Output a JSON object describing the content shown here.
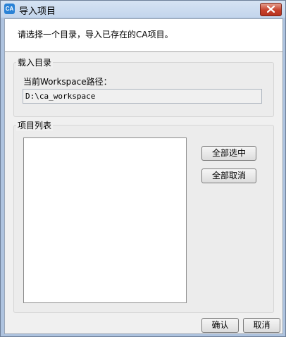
{
  "window": {
    "icon_text": "CA",
    "title": "导入项目",
    "close_icon": "close-icon"
  },
  "header": {
    "description": "请选择一个目录，导入已存在的CA项目。"
  },
  "load_dir_group": {
    "title": "载入目录",
    "workspace_label": "当前Workspace路径：",
    "workspace_path": "D:\\ca_workspace"
  },
  "project_group": {
    "title": "项目列表",
    "items": [],
    "select_all_label": "全部选中",
    "deselect_all_label": "全部取消"
  },
  "footer": {
    "confirm_label": "确认",
    "cancel_label": "取消"
  }
}
